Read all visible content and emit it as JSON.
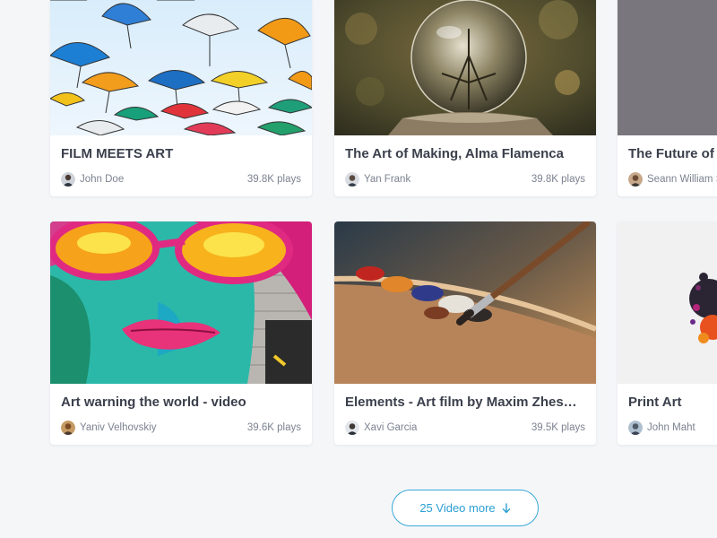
{
  "cards": [
    {
      "title": "FILM MEETS ART",
      "author": "John Doe",
      "plays": "39.8K plays",
      "thumbnail": "umbrellas-photo",
      "avatar": "avatar-john-doe"
    },
    {
      "title": "The Art of Making, Alma Flamenca",
      "author": "Yan Frank",
      "plays": "39.8K plays",
      "thumbnail": "crystal-ball-photo",
      "avatar": "avatar-yan-frank"
    },
    {
      "title": "The Future of A",
      "author": "Seann William S",
      "plays": "",
      "thumbnail": "grey-wall-photo",
      "avatar": "avatar-seann-william"
    },
    {
      "title": "Art warning the world - video",
      "author": "Yaniv Velhovskiy",
      "plays": "39.6K plays",
      "thumbnail": "graffiti-face-photo",
      "avatar": "avatar-yaniv-velhovskiy"
    },
    {
      "title": "Elements - Art film by Maxim Zhes…",
      "author": "Xavi Garcia",
      "plays": "39.5K plays",
      "thumbnail": "paint-palette-photo",
      "avatar": "avatar-xavi-garcia"
    },
    {
      "title": "Print Art",
      "author": "John Maht",
      "plays": "",
      "thumbnail": "ink-splash-photo",
      "avatar": "avatar-john-maht"
    }
  ],
  "load_more": {
    "label": "25 Video more",
    "icon": "arrow-down-icon"
  },
  "colors": {
    "background": "#f5f6f8",
    "card": "#ffffff",
    "title_text": "#3a3f4b",
    "meta_text": "#7c8290",
    "accent": "#2b9fd3"
  }
}
